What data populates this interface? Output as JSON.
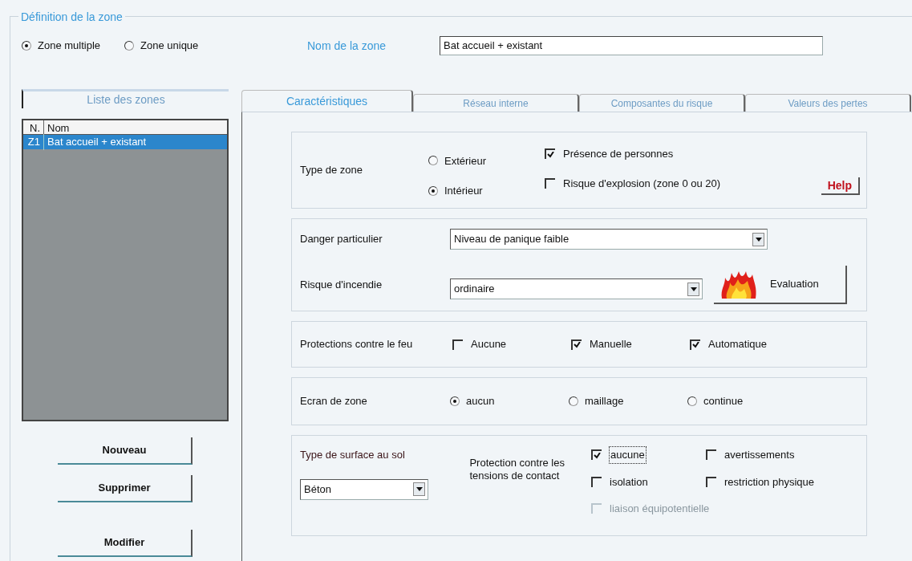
{
  "group_title": "Définition de la zone",
  "zone_mode": [
    {
      "label": "Zone multiple",
      "selected": true
    },
    {
      "label": "Zone unique",
      "selected": false
    }
  ],
  "zone_name": {
    "label": "Nom de la zone",
    "value": "Bat accueil + existant"
  },
  "zone_list": {
    "title": "Liste des zones",
    "columns": [
      "N.",
      "Nom"
    ],
    "rows": [
      {
        "n": "Z1",
        "name": "Bat accueil + existant",
        "selected": true
      }
    ]
  },
  "list_buttons": [
    "Nouveau",
    "Supprimer",
    "Modifier"
  ],
  "tabs": [
    {
      "label": "Caractéristiques",
      "selected": true
    },
    {
      "label": "Réseau interne",
      "selected": false
    },
    {
      "label": "Composantes du risque",
      "selected": false
    },
    {
      "label": "Valeurs des pertes",
      "selected": false
    }
  ],
  "type_zone": {
    "label": "Type de zone",
    "options": [
      {
        "label": "Extérieur",
        "selected": false
      },
      {
        "label": "Intérieur",
        "selected": true
      }
    ],
    "checks": [
      {
        "label": "Présence de personnes",
        "checked": true
      },
      {
        "label": "Risque d'explosion (zone 0 ou 20)",
        "checked": false
      }
    ],
    "help": "Help"
  },
  "danger": {
    "label": "Danger particulier",
    "value": "Niveau de panique faible"
  },
  "incendie": {
    "label": "Risque d'incendie",
    "value": "ordinaire",
    "button": "Evaluation"
  },
  "feu": {
    "label": "Protections contre le feu",
    "options": [
      {
        "label": "Aucune",
        "checked": false
      },
      {
        "label": "Manuelle",
        "checked": true
      },
      {
        "label": "Automatique",
        "checked": true
      }
    ]
  },
  "ecran": {
    "label": "Ecran de zone",
    "options": [
      {
        "label": "aucun",
        "selected": true
      },
      {
        "label": "maillage",
        "selected": false
      },
      {
        "label": "continue",
        "selected": false
      }
    ]
  },
  "sol": {
    "label": "Type de surface au sol",
    "value": "Béton"
  },
  "contact": {
    "label": "Protection contre les tensions de contact",
    "options": [
      {
        "label": "aucune",
        "checked": true,
        "disabled": false,
        "focused": true
      },
      {
        "label": "avertissements",
        "checked": false,
        "disabled": false,
        "focused": false
      },
      {
        "label": "isolation",
        "checked": false,
        "disabled": false,
        "focused": false
      },
      {
        "label": "restriction physique",
        "checked": false,
        "disabled": false,
        "focused": false
      },
      {
        "label": "liaison équipotentielle",
        "checked": false,
        "disabled": true,
        "focused": false
      }
    ]
  }
}
